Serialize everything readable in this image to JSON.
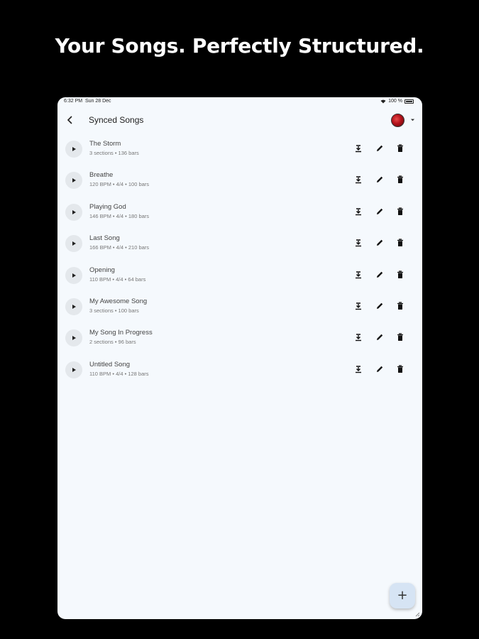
{
  "headline": "Your Songs. Perfectly Structured.",
  "status": {
    "time": "6:32 PM",
    "date": "Sun 28 Dec",
    "battery": "100 %"
  },
  "appbar": {
    "title": "Synced Songs"
  },
  "songs": [
    {
      "title": "The Storm",
      "subtitle": "3 sections • 136 bars"
    },
    {
      "title": "Breathe",
      "subtitle": "120 BPM • 4/4 • 100 bars"
    },
    {
      "title": "Playing God",
      "subtitle": "146 BPM • 4/4 • 180 bars"
    },
    {
      "title": "Last Song",
      "subtitle": "166 BPM • 4/4 • 210 bars"
    },
    {
      "title": "Opening",
      "subtitle": "110 BPM • 4/4 • 64 bars"
    },
    {
      "title": "My Awesome Song",
      "subtitle": "3 sections • 100 bars"
    },
    {
      "title": "My Song In Progress",
      "subtitle": "2 sections • 96 bars"
    },
    {
      "title": "Untitled Song",
      "subtitle": "110 BPM • 4/4 • 128 bars"
    }
  ],
  "fab": {
    "label": "+"
  },
  "colors": {
    "background": "#000000",
    "screen": "#f5f9fd",
    "fab": "#d6e4f4",
    "avatar": "#b3121b"
  }
}
